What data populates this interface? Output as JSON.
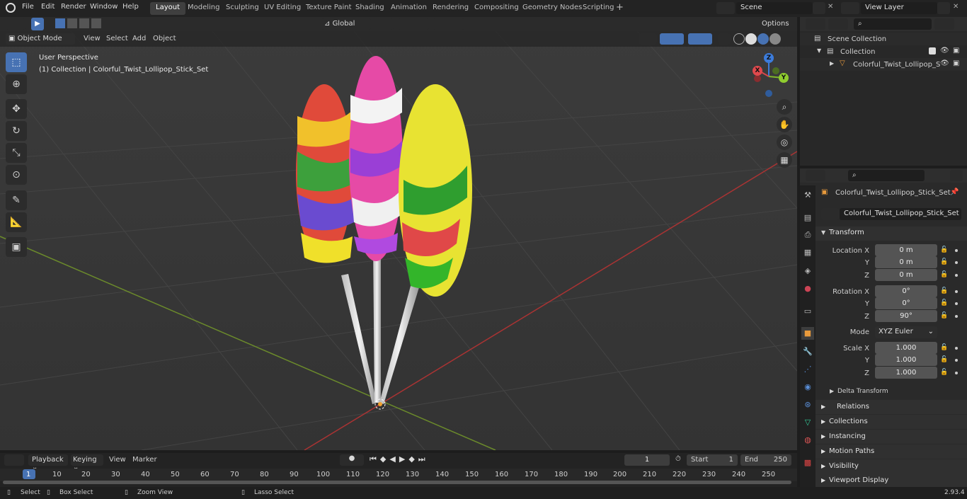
{
  "topbar": {
    "menus": [
      "File",
      "Edit",
      "Render",
      "Window",
      "Help"
    ],
    "workspaces": [
      "Layout",
      "Modeling",
      "Sculpting",
      "UV Editing",
      "Texture Paint",
      "Shading",
      "Animation",
      "Rendering",
      "Compositing",
      "Geometry Nodes",
      "Scripting"
    ],
    "active_workspace": "Layout",
    "scene": "Scene",
    "view_layer": "View Layer"
  },
  "toolheader": {
    "orientation": "Global",
    "options": "Options"
  },
  "viewport_header": {
    "mode": "Object Mode",
    "menus": [
      "View",
      "Select",
      "Add",
      "Object"
    ]
  },
  "viewport": {
    "perspective": "User Perspective",
    "collection_info": "(1) Collection | Colorful_Twist_Lollipop_Stick_Set",
    "axis_x": "X",
    "axis_y": "Y",
    "axis_z": "Z"
  },
  "outliner": {
    "scene_collection": "Scene Collection",
    "collection": "Collection",
    "object": "Colorful_Twist_Lollipop_S"
  },
  "properties": {
    "object_name": "Colorful_Twist_Lollipop_Stick_Set",
    "data_name": "Colorful_Twist_Lollipop_Stick_Set",
    "transform_title": "Transform",
    "location_label": "Location X",
    "location": [
      "0 m",
      "0 m",
      "0 m"
    ],
    "rotation_label": "Rotation X",
    "rotation": [
      "0°",
      "0°",
      "90°"
    ],
    "mode_label": "Mode",
    "mode": "XYZ Euler",
    "scale_label": "Scale X",
    "scale": [
      "1.000",
      "1.000",
      "1.000"
    ],
    "y_label": "Y",
    "z_label": "Z",
    "delta": "Delta Transform",
    "sections": [
      "Relations",
      "Collections",
      "Instancing",
      "Motion Paths",
      "Visibility",
      "Viewport Display"
    ]
  },
  "timeline": {
    "menus": [
      "Playback",
      "Keying",
      "View",
      "Marker"
    ],
    "current_frame": "1",
    "start_label": "Start",
    "start": "1",
    "end_label": "End",
    "end": "250",
    "ruler": [
      "1",
      "10",
      "20",
      "30",
      "40",
      "50",
      "60",
      "70",
      "80",
      "90",
      "100",
      "110",
      "120",
      "130",
      "140",
      "150",
      "160",
      "170",
      "180",
      "190",
      "200",
      "210",
      "220",
      "230",
      "240",
      "250"
    ]
  },
  "status": {
    "select": "Select",
    "box_select": "Box Select",
    "zoom_view": "Zoom View",
    "lasso_select": "Lasso Select",
    "version": "2.93.4"
  }
}
